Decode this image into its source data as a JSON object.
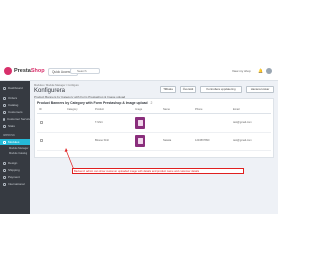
{
  "topbar": {
    "logo_text_a": "Presta",
    "logo_text_b": "Shop",
    "quick_access": "Quick Access ▾",
    "search_placeholder": "Search",
    "store_link": "View my shop"
  },
  "sidebar": {
    "items": [
      {
        "label": "Dashboard",
        "icon": "dashboard-icon"
      },
      {
        "label": "Orders",
        "icon": "cart-icon"
      },
      {
        "label": "Catalog",
        "icon": "store-icon"
      },
      {
        "label": "Customers",
        "icon": "user-icon"
      },
      {
        "label": "Customer Service",
        "icon": "chat-icon"
      },
      {
        "label": "Stats",
        "icon": "stats-icon"
      }
    ],
    "section": "IMPROVE",
    "active": "Modules",
    "sub_items": [
      "Module Manager",
      "Module Catalog"
    ],
    "more_items": [
      "Design",
      "Shipping",
      "Payment",
      "International"
    ]
  },
  "header": {
    "breadcrumb": "Modules  /  Module Manager  /  Configure",
    "title": "Konfigurera",
    "subtitle": "Product Banners by Category with Form Prestashop & Image upload",
    "buttons": [
      "Tillbaka",
      "Översätt",
      "Kontrollera uppdatering",
      "Hantera krokar"
    ]
  },
  "panel": {
    "heading": "Product Banners by Category with Form Prestashop & Image upload",
    "count": "2",
    "columns": [
      "ID",
      "Category",
      "Product",
      "Image",
      "Name",
      "Phone",
      "Email"
    ],
    "rows": [
      {
        "id": "",
        "category": "",
        "product": "T-Shirt",
        "name": "",
        "phone": "",
        "email": "test@gmail.com"
      },
      {
        "id": "",
        "category": "",
        "product": "Blouse Shirt",
        "name": "Nataša",
        "phone": "1234567890",
        "email": "test@gmail.com"
      }
    ]
  },
  "annotation": {
    "text": "Backend: admin can show customer uploaded image with details and product name and customer details"
  },
  "colors": {
    "accent": "#25b9d7",
    "sidebar": "#363a41",
    "brand": "#d8306b",
    "annotation": "#e02020",
    "thumb": "#8a2e7c"
  }
}
